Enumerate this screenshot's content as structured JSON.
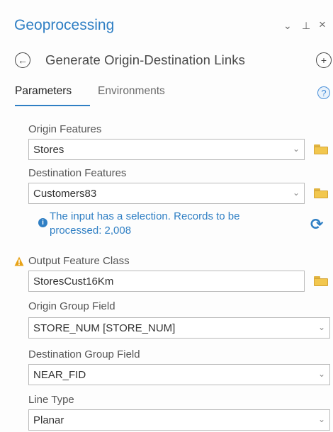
{
  "pane": {
    "title": "Geoprocessing",
    "controls": {
      "menu": "⌄",
      "pin": "⊥",
      "close": "×"
    }
  },
  "tool": {
    "title": "Generate Origin-Destination Links",
    "back_icon": "back-arrow-icon",
    "add_icon": "add-icon"
  },
  "tabs": [
    {
      "label": "Parameters",
      "active": true
    },
    {
      "label": "Environments",
      "active": false
    }
  ],
  "help_glyph": "?",
  "params": {
    "origin_features": {
      "label": "Origin Features",
      "value": "Stores"
    },
    "destination_features": {
      "label": "Destination Features",
      "value": "Customers83"
    },
    "selection_info": "The input has a selection. Records to be processed: 2,008",
    "output_feature_class": {
      "label": "Output Feature Class",
      "value": "StoresCust16Km"
    },
    "origin_group_field": {
      "label": "Origin Group Field",
      "value": "STORE_NUM [STORE_NUM]"
    },
    "destination_group_field": {
      "label": "Destination Group Field",
      "value": "NEAR_FID"
    },
    "line_type": {
      "label": "Line Type",
      "value": "Planar"
    }
  },
  "colors": {
    "accent": "#2f7fc4",
    "warning": "#e8a317",
    "folder": "#f2c74e"
  }
}
